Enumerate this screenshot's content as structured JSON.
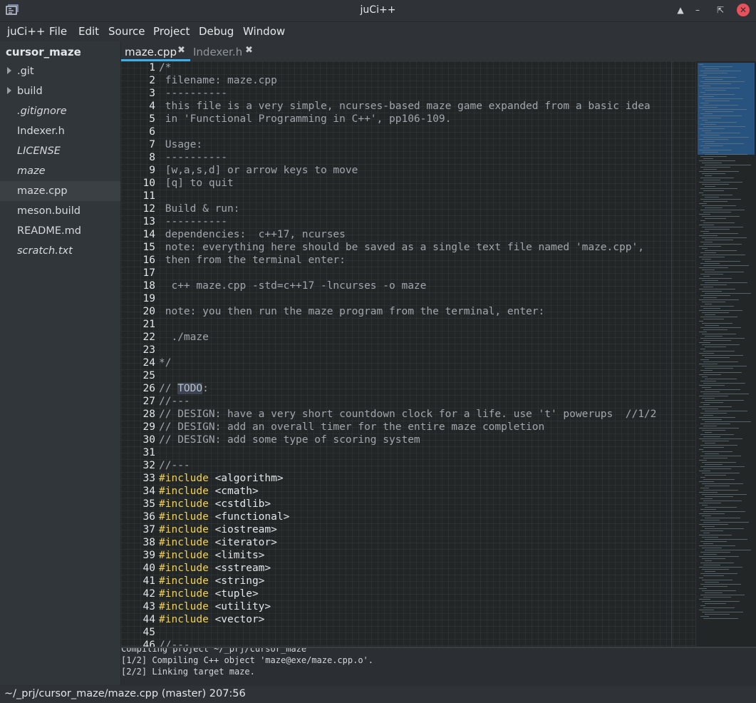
{
  "window": {
    "title": "juCi++",
    "controls": [
      "up-arrow-icon",
      "minimize-icon",
      "restore-icon",
      "close-icon"
    ]
  },
  "menubar": {
    "items": [
      "juCi++",
      "File",
      "Edit",
      "Source",
      "Project",
      "Debug",
      "Window"
    ]
  },
  "sidebar": {
    "project": "cursor_maze",
    "items": [
      {
        "label": ".git",
        "type": "folder"
      },
      {
        "label": "build",
        "type": "folder"
      },
      {
        "label": ".gitignore",
        "type": "file",
        "italic": true
      },
      {
        "label": "Indexer.h",
        "type": "file",
        "italic": false
      },
      {
        "label": "LICENSE",
        "type": "file",
        "italic": true
      },
      {
        "label": "maze",
        "type": "file",
        "italic": true
      },
      {
        "label": "maze.cpp",
        "type": "file",
        "italic": false,
        "selected": true
      },
      {
        "label": "meson.build",
        "type": "file",
        "italic": false
      },
      {
        "label": "README.md",
        "type": "file",
        "italic": false
      },
      {
        "label": "scratch.txt",
        "type": "file",
        "italic": true
      }
    ]
  },
  "tabs": [
    {
      "label": "maze.cpp",
      "active": true
    },
    {
      "label": "Indexer.h",
      "active": false
    }
  ],
  "editor": {
    "lines": [
      {
        "n": "1",
        "t": "/*"
      },
      {
        "n": "2",
        "t": " filename: maze.cpp"
      },
      {
        "n": "3",
        "t": " ----------"
      },
      {
        "n": "4",
        "t": " this file is a very simple, ncurses-based maze game expanded from a basic idea"
      },
      {
        "n": "5",
        "t": " in 'Functional Programming in C++', pp106-109."
      },
      {
        "n": "6",
        "t": ""
      },
      {
        "n": "7",
        "t": " Usage:"
      },
      {
        "n": "8",
        "t": " ----------"
      },
      {
        "n": "9",
        "t": " [w,a,s,d] or arrow keys to move"
      },
      {
        "n": "10",
        "t": " [q] to quit"
      },
      {
        "n": "11",
        "t": ""
      },
      {
        "n": "12",
        "t": " Build & run:"
      },
      {
        "n": "13",
        "t": " ----------"
      },
      {
        "n": "14",
        "t": " dependencies:  c++17, ncurses"
      },
      {
        "n": "15",
        "t": " note: everything here should be saved as a single text file named 'maze.cpp',"
      },
      {
        "n": "16",
        "t": " then from the terminal enter:"
      },
      {
        "n": "17",
        "t": ""
      },
      {
        "n": "18",
        "t": "  c++ maze.cpp -std=c++17 -lncurses -o maze"
      },
      {
        "n": "19",
        "t": ""
      },
      {
        "n": "20",
        "t": " note: you then run the maze program from the terminal, enter:"
      },
      {
        "n": "21",
        "t": ""
      },
      {
        "n": "22",
        "t": "  ./maze"
      },
      {
        "n": "23",
        "t": ""
      },
      {
        "n": "24",
        "t": "*/"
      },
      {
        "n": "25",
        "t": ""
      },
      {
        "n": "26",
        "t": "// ",
        "hl": "TODO",
        "after": ":"
      },
      {
        "n": "27",
        "t": "//---"
      },
      {
        "n": "28",
        "t": "// DESIGN: have a very short countdown clock for a life. use 't' powerups  //1/2"
      },
      {
        "n": "29",
        "t": "// DESIGN: add an overall timer for the entire maze completion"
      },
      {
        "n": "30",
        "t": "// DESIGN: add some type of scoring system"
      },
      {
        "n": "31",
        "t": ""
      },
      {
        "n": "32",
        "t": "//---"
      },
      {
        "n": "33",
        "kw": "#include",
        "t": " <algorithm>"
      },
      {
        "n": "34",
        "kw": "#include",
        "t": " <cmath>"
      },
      {
        "n": "35",
        "kw": "#include",
        "t": " <cstdlib>"
      },
      {
        "n": "36",
        "kw": "#include",
        "t": " <functional>"
      },
      {
        "n": "37",
        "kw": "#include",
        "t": " <iostream>"
      },
      {
        "n": "38",
        "kw": "#include",
        "t": " <iterator>"
      },
      {
        "n": "39",
        "kw": "#include",
        "t": " <limits>"
      },
      {
        "n": "40",
        "kw": "#include",
        "t": " <sstream>"
      },
      {
        "n": "41",
        "kw": "#include",
        "t": " <string>"
      },
      {
        "n": "42",
        "kw": "#include",
        "t": " <tuple>"
      },
      {
        "n": "43",
        "kw": "#include",
        "t": " <utility>"
      },
      {
        "n": "44",
        "kw": "#include",
        "t": " <vector>"
      },
      {
        "n": "45",
        "t": ""
      },
      {
        "n": "46",
        "t": "//---"
      }
    ]
  },
  "terminal": {
    "lines": [
      "Compiling project ~/_prj/cursor_maze",
      "[1/2] Compiling C++ object 'maze@exe/maze.cpp.o'.",
      "[2/2] Linking target maze."
    ]
  },
  "statusbar": {
    "text": "~/_prj/cursor_maze/maze.cpp (master) 207:56"
  },
  "colors": {
    "background": "#2b2e33",
    "editor_bg": "#232627",
    "keyword": "#f3d24a",
    "comment": "#a0a7ac",
    "accent": "#3daee9",
    "close_button": "#e8505b"
  }
}
